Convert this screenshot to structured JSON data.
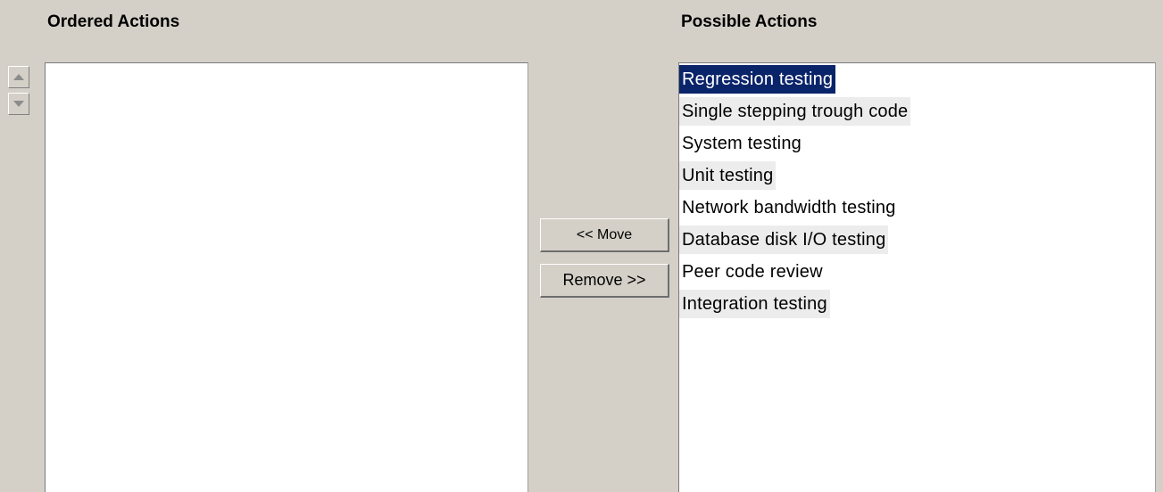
{
  "ordered_panel": {
    "title": "Ordered Actions",
    "items": []
  },
  "possible_panel": {
    "title": "Possible Actions",
    "items": [
      {
        "label": "Regression testing",
        "selected": true
      },
      {
        "label": "Single stepping trough code",
        "selected": false
      },
      {
        "label": "System testing",
        "selected": false
      },
      {
        "label": "Unit testing",
        "selected": false
      },
      {
        "label": "Network bandwidth testing",
        "selected": false
      },
      {
        "label": "Database disk I/O testing",
        "selected": false
      },
      {
        "label": "Peer code review",
        "selected": false
      },
      {
        "label": "Integration testing",
        "selected": false
      }
    ]
  },
  "controls": {
    "move_label": "<< Move",
    "remove_label": "Remove >>",
    "scroll_up_icon": "arrow-up-icon",
    "scroll_down_icon": "arrow-down-icon"
  },
  "colors": {
    "background": "#d4d0c8",
    "selection": "#0a246a",
    "selection_text": "#ffffff",
    "alt_row": "#ececec"
  }
}
